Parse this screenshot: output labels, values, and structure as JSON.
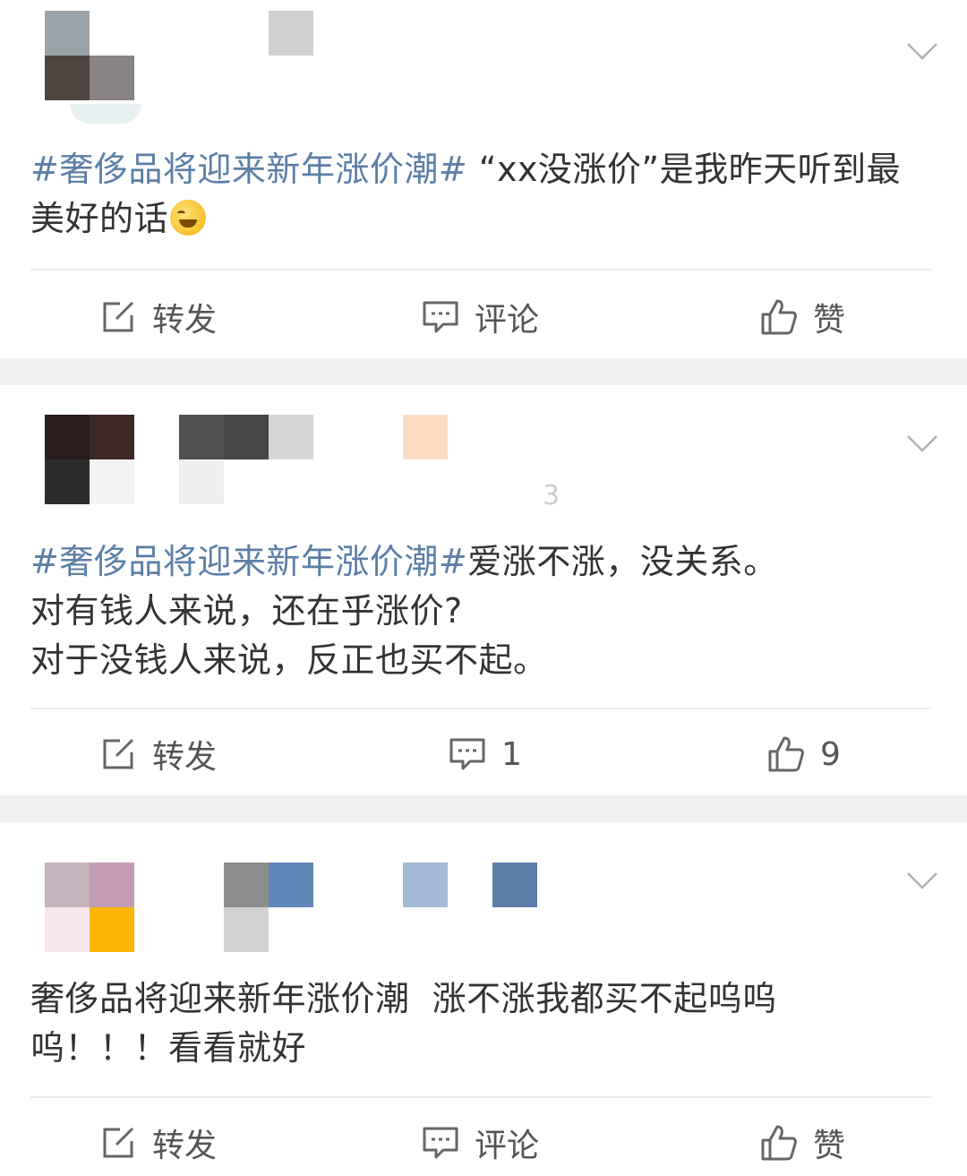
{
  "posts": [
    {
      "topic": "#奢侈品将迎来新年涨价潮#",
      "text_lines": [
        " “xx没涨价”是我昨天听到最",
        "美好的话"
      ],
      "emoji": "laughing-tears-emoji",
      "actions": {
        "repost": "转发",
        "comment": "评论",
        "like": "赞"
      }
    },
    {
      "topic": "#奢侈品将迎来新年涨价潮#",
      "username_fragment": "3",
      "text_lines": [
        "爱涨不涨，没关系。",
        "对有钱人来说，还在乎涨价?",
        "对于没钱人来说，反正也买不起。"
      ],
      "actions": {
        "repost": "转发",
        "comment_count": "1",
        "like_count": "9"
      }
    },
    {
      "text_lines": [
        "奢侈品将迎来新年涨价潮  涨不涨我都买不起呜呜",
        "呜！！！看看就好"
      ],
      "actions": {
        "repost": "转发",
        "comment": "评论",
        "like": "赞"
      }
    }
  ],
  "colors": {
    "topic_link": "#5b7fa6",
    "body_text": "#333333",
    "action_text": "#555555",
    "separator": "#f1f1f1"
  },
  "icons": [
    "repost-icon",
    "comment-icon",
    "like-icon",
    "chevron-down-icon"
  ]
}
